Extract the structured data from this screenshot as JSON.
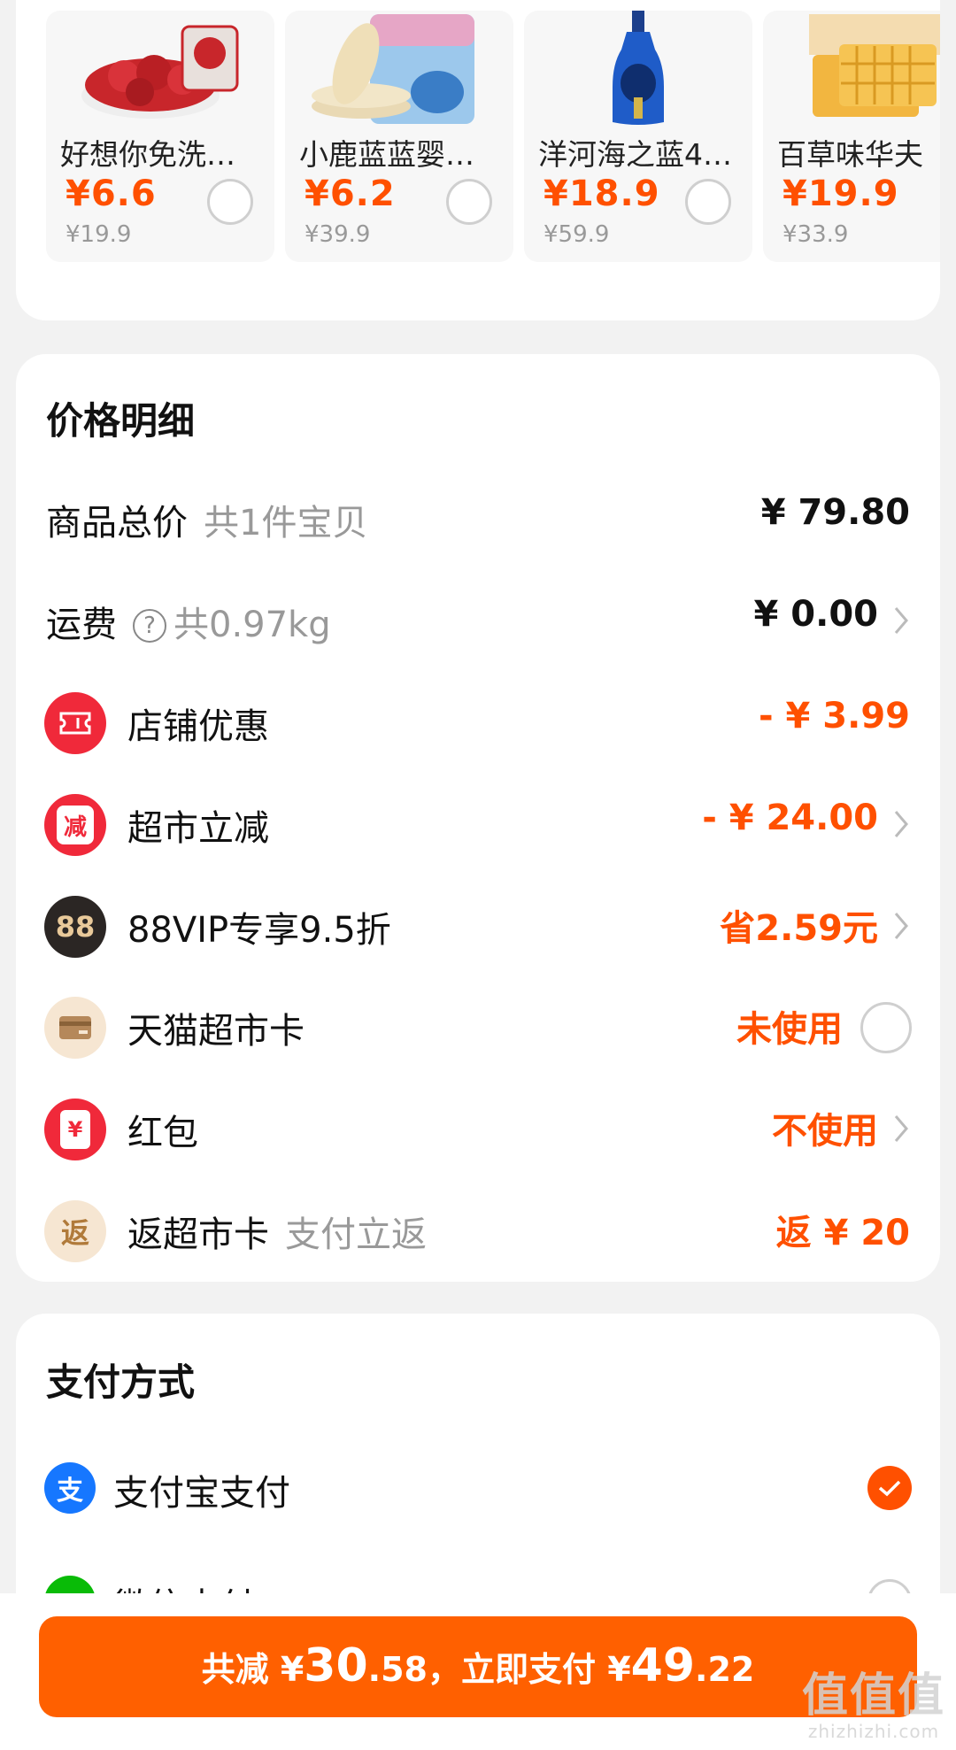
{
  "recommend": [
    {
      "name": "好想你免洗…",
      "price": "¥6.6",
      "original": "¥19.9"
    },
    {
      "name": "小鹿蓝蓝婴…",
      "price": "¥6.2",
      "original": "¥39.9"
    },
    {
      "name": "洋河海之蓝4…",
      "price": "¥18.9",
      "original": "¥59.9"
    },
    {
      "name": "百草味华夫",
      "price": "¥19.9",
      "original": "¥33.9"
    }
  ],
  "price_detail": {
    "title": "价格明细",
    "goods_total": {
      "label": "商品总价",
      "sub": "共1件宝贝",
      "value": "¥ 79.80"
    },
    "shipping": {
      "label": "运费",
      "help": "?",
      "sub": "共0.97kg",
      "value": "¥ 0.00"
    },
    "shop_discount": {
      "label": "店铺优惠",
      "value": "- ¥ 3.99"
    },
    "market_discount": {
      "label": "超市立减",
      "icon_text": "减",
      "value": "- ¥ 24.00"
    },
    "vip": {
      "label": "88VIP专享9.5折",
      "icon_text": "88",
      "value": "省2.59元"
    },
    "market_card": {
      "label": "天猫超市卡",
      "value": "未使用"
    },
    "red_packet": {
      "label": "红包",
      "icon_text": "¥",
      "value": "不使用"
    },
    "rebate": {
      "label": "返超市卡",
      "icon_text": "返",
      "sub": "支付立返",
      "value": "返 ¥ 20"
    }
  },
  "payment": {
    "title": "支付方式",
    "alipay": {
      "label": "支付宝支付",
      "icon_text": "支"
    },
    "wechat": {
      "label": "微信支付"
    }
  },
  "bottom": {
    "prefix": "共减 ¥",
    "saved_int": "30",
    "saved_dec": ".58",
    "middle": "，立即支付 ¥",
    "pay_int": "49",
    "pay_dec": ".22"
  },
  "watermark": {
    "cn": "值值值",
    "en": "zhizhizhi.com"
  },
  "colors": {
    "accent": "#ff5000",
    "button": "#ff6000",
    "red_icon": "#f0293a",
    "alipay": "#1677ff",
    "wechat": "#09bb07"
  }
}
